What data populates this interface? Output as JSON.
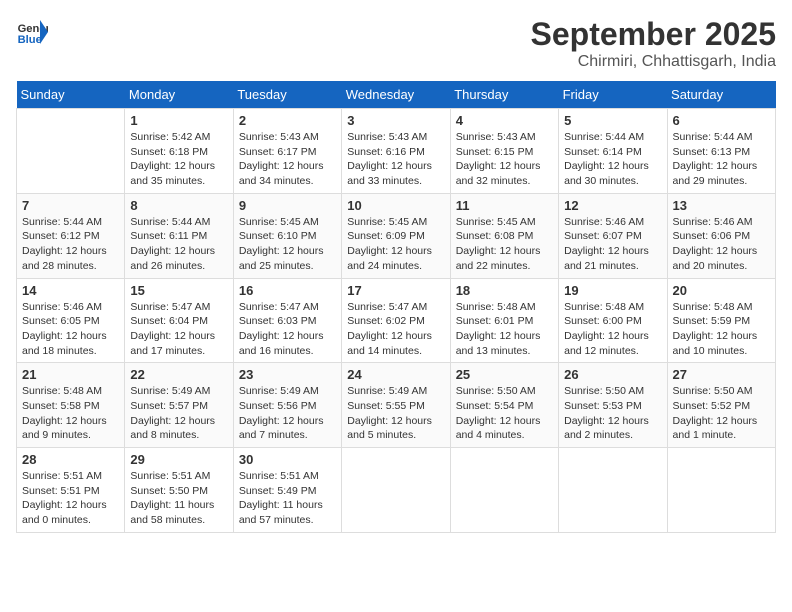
{
  "header": {
    "logo_line1": "General",
    "logo_line2": "Blue",
    "month_year": "September 2025",
    "location": "Chirmiri, Chhattisgarh, India"
  },
  "days_of_week": [
    "Sunday",
    "Monday",
    "Tuesday",
    "Wednesday",
    "Thursday",
    "Friday",
    "Saturday"
  ],
  "weeks": [
    [
      {
        "day": "",
        "info": ""
      },
      {
        "day": "1",
        "info": "Sunrise: 5:42 AM\nSunset: 6:18 PM\nDaylight: 12 hours\nand 35 minutes."
      },
      {
        "day": "2",
        "info": "Sunrise: 5:43 AM\nSunset: 6:17 PM\nDaylight: 12 hours\nand 34 minutes."
      },
      {
        "day": "3",
        "info": "Sunrise: 5:43 AM\nSunset: 6:16 PM\nDaylight: 12 hours\nand 33 minutes."
      },
      {
        "day": "4",
        "info": "Sunrise: 5:43 AM\nSunset: 6:15 PM\nDaylight: 12 hours\nand 32 minutes."
      },
      {
        "day": "5",
        "info": "Sunrise: 5:44 AM\nSunset: 6:14 PM\nDaylight: 12 hours\nand 30 minutes."
      },
      {
        "day": "6",
        "info": "Sunrise: 5:44 AM\nSunset: 6:13 PM\nDaylight: 12 hours\nand 29 minutes."
      }
    ],
    [
      {
        "day": "7",
        "info": "Sunrise: 5:44 AM\nSunset: 6:12 PM\nDaylight: 12 hours\nand 28 minutes."
      },
      {
        "day": "8",
        "info": "Sunrise: 5:44 AM\nSunset: 6:11 PM\nDaylight: 12 hours\nand 26 minutes."
      },
      {
        "day": "9",
        "info": "Sunrise: 5:45 AM\nSunset: 6:10 PM\nDaylight: 12 hours\nand 25 minutes."
      },
      {
        "day": "10",
        "info": "Sunrise: 5:45 AM\nSunset: 6:09 PM\nDaylight: 12 hours\nand 24 minutes."
      },
      {
        "day": "11",
        "info": "Sunrise: 5:45 AM\nSunset: 6:08 PM\nDaylight: 12 hours\nand 22 minutes."
      },
      {
        "day": "12",
        "info": "Sunrise: 5:46 AM\nSunset: 6:07 PM\nDaylight: 12 hours\nand 21 minutes."
      },
      {
        "day": "13",
        "info": "Sunrise: 5:46 AM\nSunset: 6:06 PM\nDaylight: 12 hours\nand 20 minutes."
      }
    ],
    [
      {
        "day": "14",
        "info": "Sunrise: 5:46 AM\nSunset: 6:05 PM\nDaylight: 12 hours\nand 18 minutes."
      },
      {
        "day": "15",
        "info": "Sunrise: 5:47 AM\nSunset: 6:04 PM\nDaylight: 12 hours\nand 17 minutes."
      },
      {
        "day": "16",
        "info": "Sunrise: 5:47 AM\nSunset: 6:03 PM\nDaylight: 12 hours\nand 16 minutes."
      },
      {
        "day": "17",
        "info": "Sunrise: 5:47 AM\nSunset: 6:02 PM\nDaylight: 12 hours\nand 14 minutes."
      },
      {
        "day": "18",
        "info": "Sunrise: 5:48 AM\nSunset: 6:01 PM\nDaylight: 12 hours\nand 13 minutes."
      },
      {
        "day": "19",
        "info": "Sunrise: 5:48 AM\nSunset: 6:00 PM\nDaylight: 12 hours\nand 12 minutes."
      },
      {
        "day": "20",
        "info": "Sunrise: 5:48 AM\nSunset: 5:59 PM\nDaylight: 12 hours\nand 10 minutes."
      }
    ],
    [
      {
        "day": "21",
        "info": "Sunrise: 5:48 AM\nSunset: 5:58 PM\nDaylight: 12 hours\nand 9 minutes."
      },
      {
        "day": "22",
        "info": "Sunrise: 5:49 AM\nSunset: 5:57 PM\nDaylight: 12 hours\nand 8 minutes."
      },
      {
        "day": "23",
        "info": "Sunrise: 5:49 AM\nSunset: 5:56 PM\nDaylight: 12 hours\nand 7 minutes."
      },
      {
        "day": "24",
        "info": "Sunrise: 5:49 AM\nSunset: 5:55 PM\nDaylight: 12 hours\nand 5 minutes."
      },
      {
        "day": "25",
        "info": "Sunrise: 5:50 AM\nSunset: 5:54 PM\nDaylight: 12 hours\nand 4 minutes."
      },
      {
        "day": "26",
        "info": "Sunrise: 5:50 AM\nSunset: 5:53 PM\nDaylight: 12 hours\nand 2 minutes."
      },
      {
        "day": "27",
        "info": "Sunrise: 5:50 AM\nSunset: 5:52 PM\nDaylight: 12 hours\nand 1 minute."
      }
    ],
    [
      {
        "day": "28",
        "info": "Sunrise: 5:51 AM\nSunset: 5:51 PM\nDaylight: 12 hours\nand 0 minutes."
      },
      {
        "day": "29",
        "info": "Sunrise: 5:51 AM\nSunset: 5:50 PM\nDaylight: 11 hours\nand 58 minutes."
      },
      {
        "day": "30",
        "info": "Sunrise: 5:51 AM\nSunset: 5:49 PM\nDaylight: 11 hours\nand 57 minutes."
      },
      {
        "day": "",
        "info": ""
      },
      {
        "day": "",
        "info": ""
      },
      {
        "day": "",
        "info": ""
      },
      {
        "day": "",
        "info": ""
      }
    ]
  ]
}
